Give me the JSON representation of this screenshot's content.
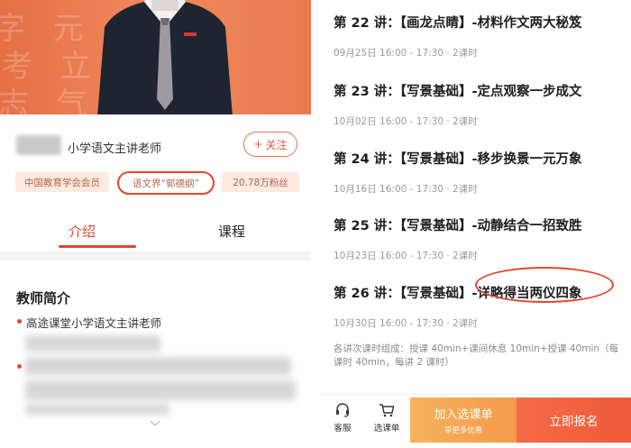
{
  "left": {
    "teacher_title": "小学语文主讲老师",
    "follow_label": "关注",
    "tags": [
      "中国教育学会会员",
      "语文界“郭德纲”",
      "20.78万粉丝"
    ],
    "tabs": [
      "介绍",
      "课程"
    ],
    "intro_title": "教师简介",
    "intro_items": [
      "高途课堂小学语文主讲老师"
    ]
  },
  "right": {
    "lessons": [
      {
        "title": "第 22 讲：【画龙点睛】-材料作文两大秘笈",
        "meta": "09月25日 16:00 - 17:30 · 2课时"
      },
      {
        "title": "第 23 讲：【写景基础】-定点观察一步成文",
        "meta": "10月02日 16:00 - 17:30 · 2课时"
      },
      {
        "title": "第 24 讲：【写景基础】-移步换景一元万象",
        "meta": "10月16日 16:00 - 17:30 · 2课时"
      },
      {
        "title": "第 25 讲：【写景基础】-动静结合一招致胜",
        "meta": "10月23日 16:00 - 17:30 · 2课时"
      },
      {
        "title": "第 26 讲：【写景基础】-详略得当两仪四象",
        "meta": "10月30日 16:00 - 17:30 · 2课时"
      }
    ],
    "note": "各讲次课时组成：授课 40min+课间休息 10min+授课 40min（每课时 40min，每讲 2 课时）",
    "bottom_bar": {
      "service_label": "客服",
      "cart_label": "选课单",
      "add_label": "加入选课单",
      "add_sub": "享更多优惠",
      "register_label": "立即报名"
    }
  },
  "colors": {
    "accent": "#e2462f",
    "hero": "#ec7a4f",
    "tag_bg": "#fde9e0",
    "add_btn": "#f4a653",
    "register_btn": "#f2603f"
  }
}
